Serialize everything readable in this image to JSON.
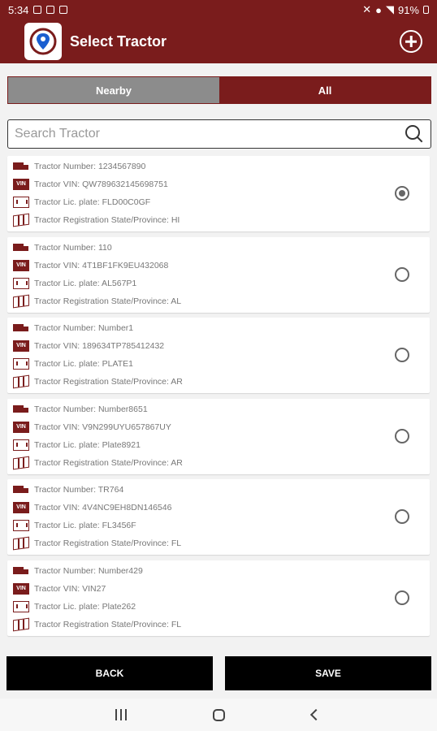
{
  "status_bar": {
    "time": "5:34",
    "battery": "91%"
  },
  "app_bar": {
    "title": "Select Tractor"
  },
  "tabs": {
    "nearby": "Nearby",
    "all": "All",
    "selected": "Nearby"
  },
  "search": {
    "placeholder": "Search Tractor",
    "value": ""
  },
  "tractors": [
    {
      "number": "Tractor Number: 1234567890",
      "vin": "Tractor VIN: QW789632145698751",
      "plate": "Tractor Lic. plate: FLD00C0GF",
      "state": "Tractor Registration State/Province: HI",
      "selected": true
    },
    {
      "number": "Tractor Number: 110",
      "vin": "Tractor VIN: 4T1BF1FK9EU432068",
      "plate": "Tractor Lic. plate: AL567P1",
      "state": "Tractor Registration State/Province: AL",
      "selected": false
    },
    {
      "number": "Tractor Number: Number1",
      "vin": "Tractor VIN: 189634TP785412432",
      "plate": "Tractor Lic. plate: PLATE1",
      "state": "Tractor Registration State/Province: AR",
      "selected": false
    },
    {
      "number": "Tractor Number: Number8651",
      "vin": "Tractor VIN: V9N299UYU657867UY",
      "plate": "Tractor Lic. plate: Plate8921",
      "state": "Tractor Registration State/Province: AR",
      "selected": false
    },
    {
      "number": "Tractor Number: TR764",
      "vin": "Tractor VIN: 4V4NC9EH8DN146546",
      "plate": "Tractor Lic. plate: FL3456F",
      "state": "Tractor Registration State/Province: FL",
      "selected": false
    },
    {
      "number": "Tractor Number: Number429",
      "vin": "Tractor VIN: VIN27",
      "plate": "Tractor Lic. plate: Plate262",
      "state": "Tractor Registration State/Province: FL",
      "selected": false
    }
  ],
  "icons": {
    "number": "truck-icon",
    "vin": "vin-icon",
    "plate": "license-plate-icon",
    "state": "map-icon",
    "vin_glyph": "VIN"
  },
  "buttons": {
    "back": "BACK",
    "save": "SAVE"
  },
  "colors": {
    "primary": "#7a1c1c",
    "tab_inactive": "#8c8c8c",
    "button": "#000000"
  }
}
